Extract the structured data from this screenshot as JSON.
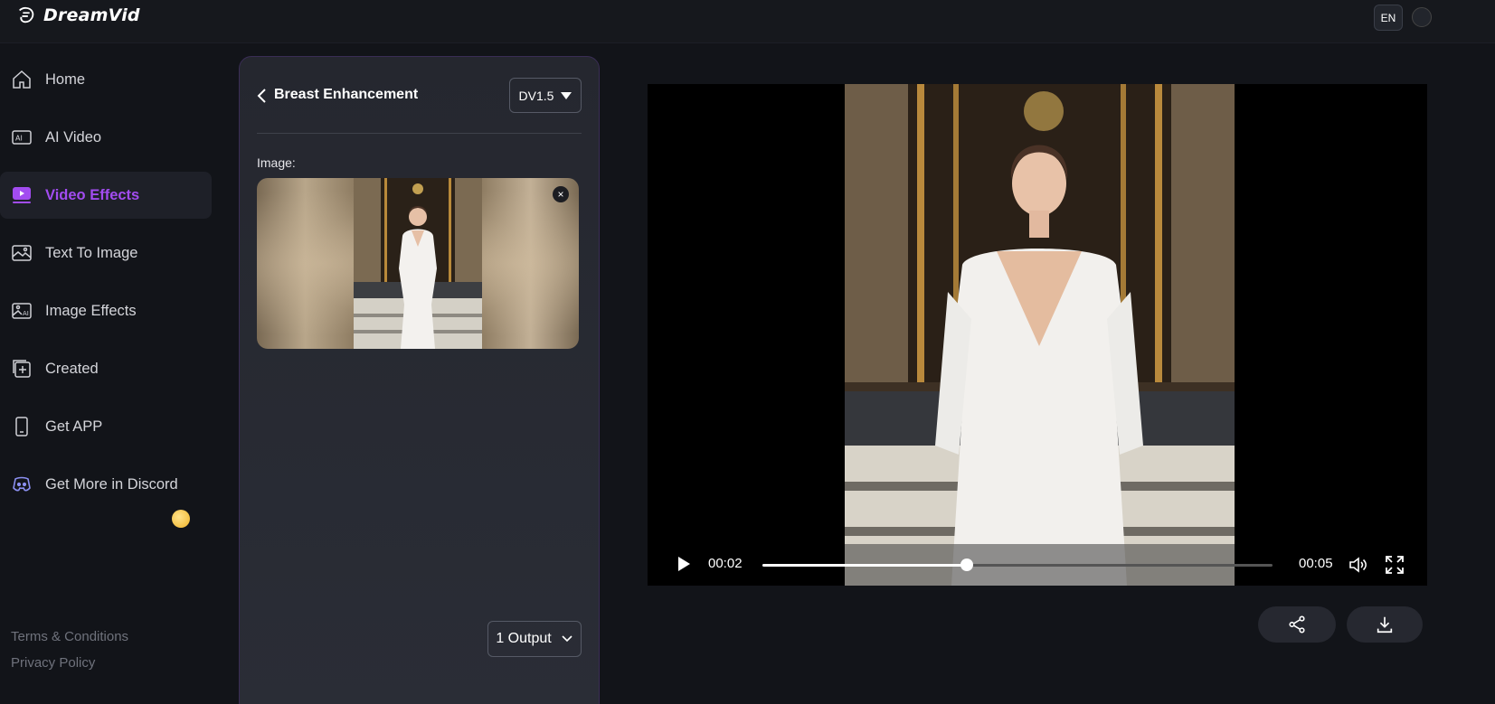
{
  "app": {
    "name": "DreamVid",
    "language": "EN"
  },
  "sidebar": {
    "items": [
      {
        "label": "Home",
        "icon": "home-icon",
        "active": false
      },
      {
        "label": "AI Video",
        "icon": "ai-video-icon",
        "active": false
      },
      {
        "label": "Video Effects",
        "icon": "video-effects-icon",
        "active": true
      },
      {
        "label": "Text To Image",
        "icon": "text-to-image-icon",
        "active": false
      },
      {
        "label": "Image Effects",
        "icon": "image-effects-icon",
        "active": false
      },
      {
        "label": "Created",
        "icon": "created-icon",
        "active": false
      },
      {
        "label": "Get APP",
        "icon": "phone-icon",
        "active": false
      },
      {
        "label": "Get More in Discord",
        "icon": "discord-icon",
        "active": false
      }
    ],
    "footer": {
      "terms": "Terms & Conditions",
      "privacy": "Privacy Policy"
    }
  },
  "panel": {
    "title": "Breast Enhancement",
    "model": "DV1.5",
    "image_label": "Image:",
    "close_symbol": "×",
    "output": "1 Output"
  },
  "player": {
    "current_time": "00:02",
    "duration": "00:05",
    "progress": 0.4
  },
  "colors": {
    "accent": "#a24cf0",
    "background": "#121419",
    "panel": "#25272f"
  }
}
